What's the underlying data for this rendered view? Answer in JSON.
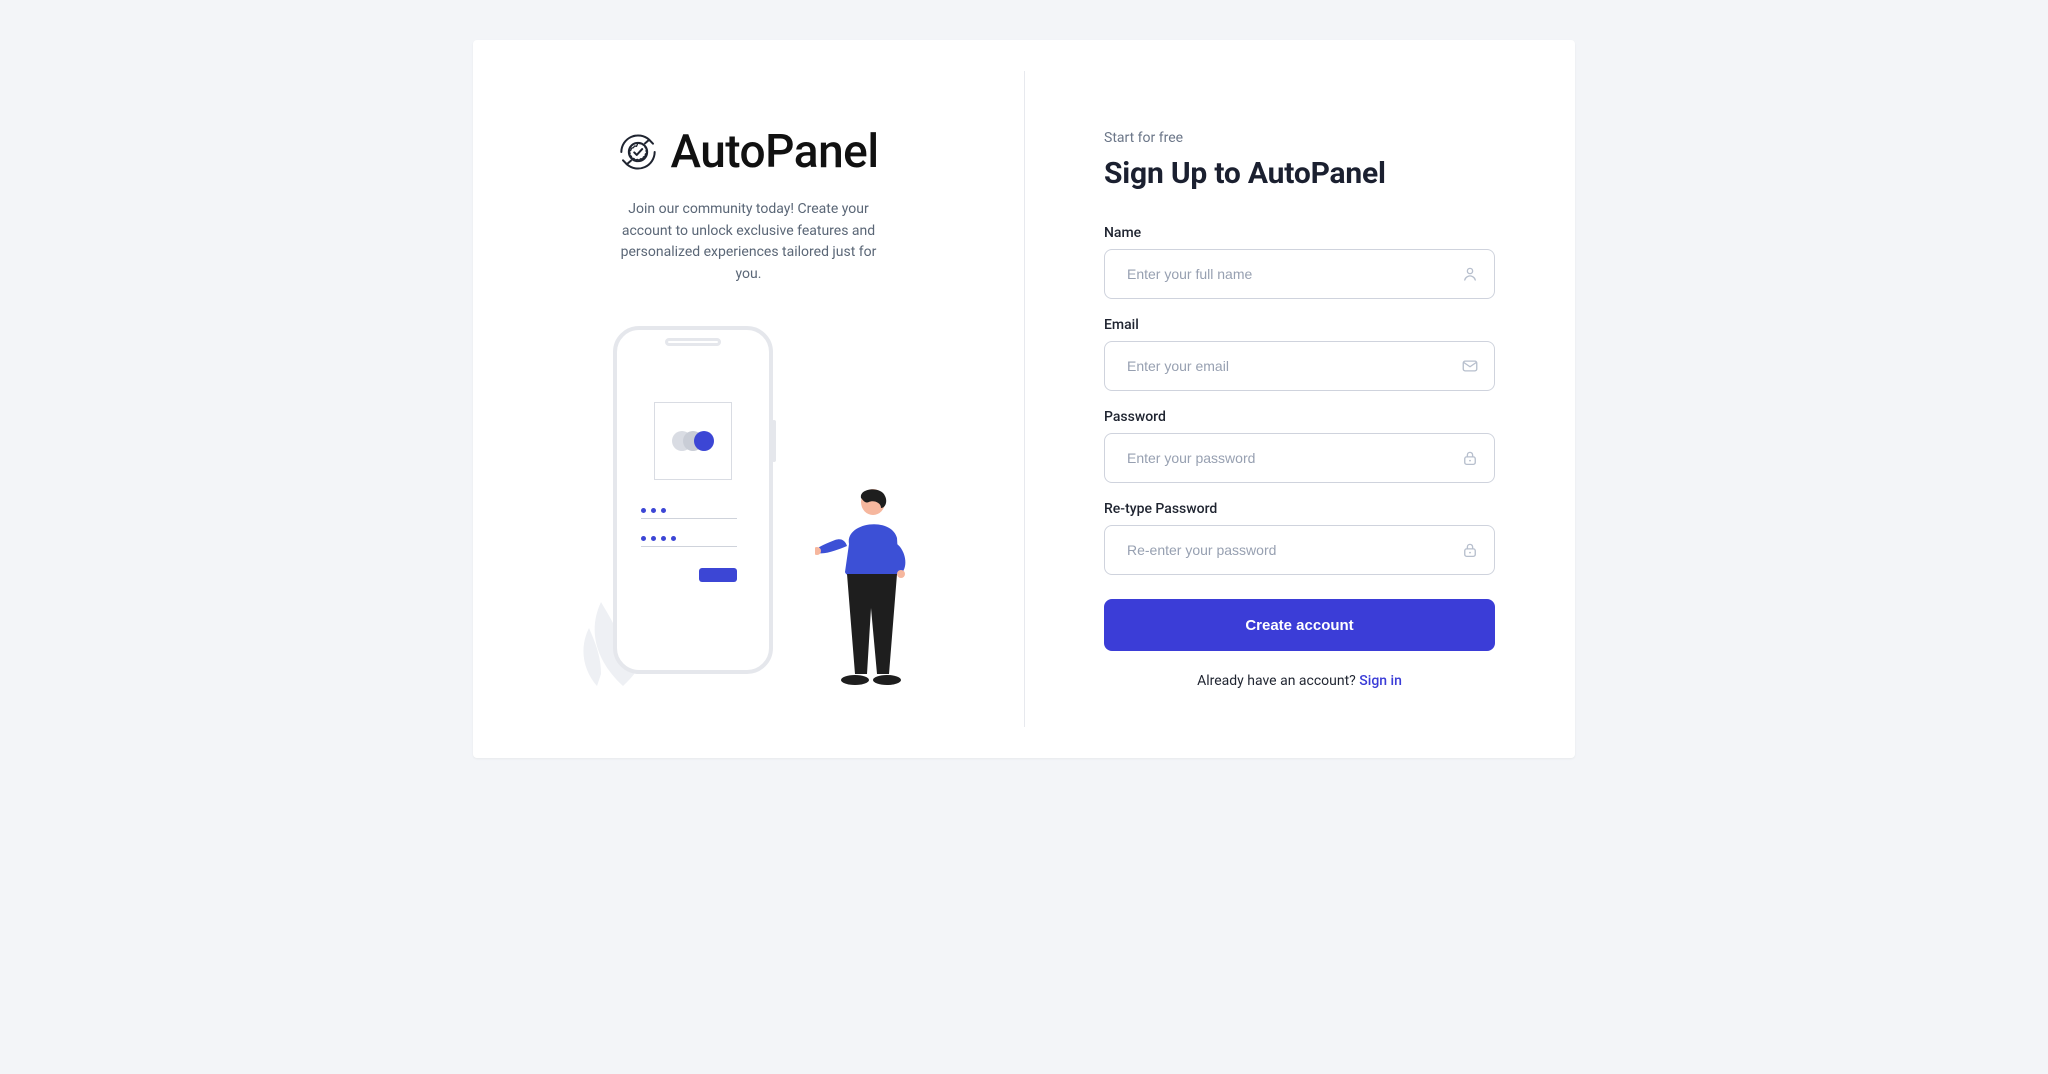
{
  "brand": {
    "name": "AutoPanel"
  },
  "intro": {
    "tagline": "Join our community today! Create your account to unlock exclusive features and personalized experiences tailored just for you."
  },
  "signup": {
    "eyebrow": "Start for free",
    "heading": "Sign Up to AutoPanel",
    "fields": {
      "name": {
        "label": "Name",
        "placeholder": "Enter your full name",
        "value": ""
      },
      "email": {
        "label": "Email",
        "placeholder": "Enter your email",
        "value": ""
      },
      "password": {
        "label": "Password",
        "placeholder": "Enter your password",
        "value": ""
      },
      "confirm": {
        "label": "Re-type Password",
        "placeholder": "Re-enter your password",
        "value": ""
      }
    },
    "submit_label": "Create account",
    "alt_prompt": "Already have an account? ",
    "alt_link_label": "Sign in"
  },
  "colors": {
    "accent": "#3b3dd7"
  }
}
